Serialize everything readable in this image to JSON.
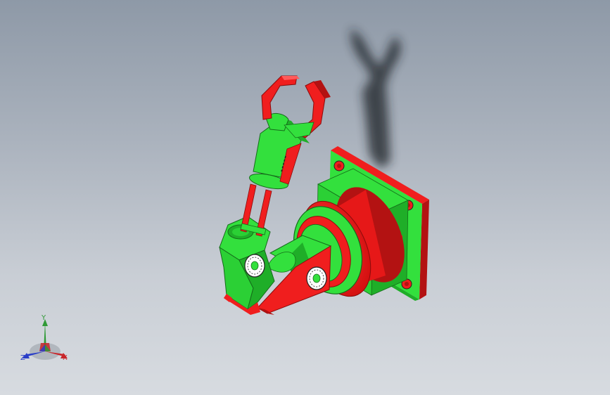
{
  "viewport": {
    "background_top": "#8e99a7",
    "background_bottom": "#d7dbe0",
    "model_colors": {
      "green": "#33e03d",
      "green_dark": "#1fae28",
      "red": "#f01e1e",
      "red_dark": "#b31212",
      "shadow": "#1f2328"
    }
  },
  "triad": {
    "y_label": "Y",
    "x_label": "X",
    "z_label": "Z",
    "x_color": "#c8262a",
    "y_color": "#2f9a36",
    "z_color": "#2a3ec8",
    "icon": "coordinate-triad-icon"
  }
}
